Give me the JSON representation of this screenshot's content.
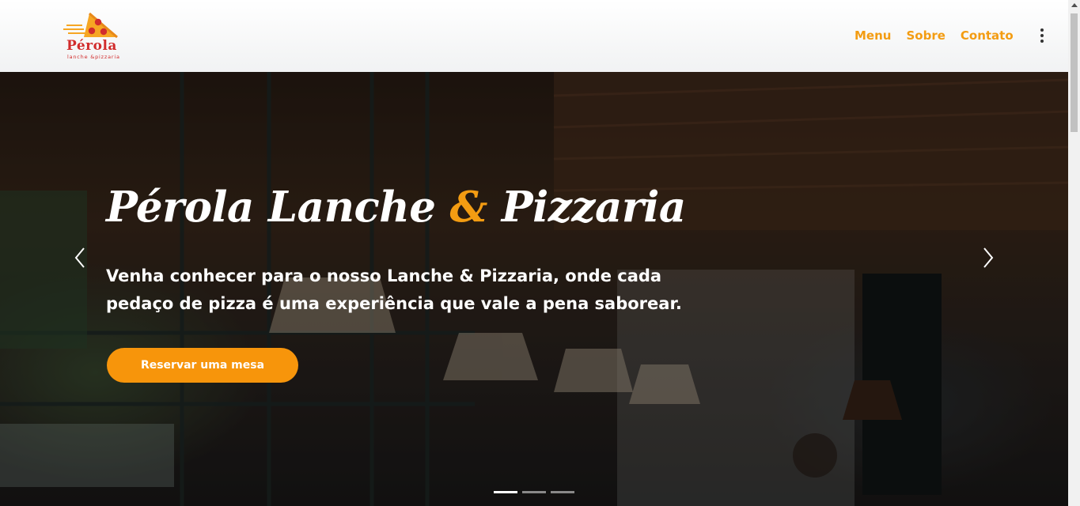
{
  "brand": {
    "name": "Pérola",
    "tagline": "lanche &pizzaria",
    "color": "#d12c2c"
  },
  "nav": {
    "links": [
      {
        "label": "Menu"
      },
      {
        "label": "Sobre"
      },
      {
        "label": "Contato"
      }
    ],
    "more_icon": "more-vertical-icon",
    "accent": "#f39c12"
  },
  "hero": {
    "title_part1": "Pérola Lanche",
    "title_amp": "&",
    "title_part2": "Pizzaria",
    "text": "Venha conhecer para o nosso Lanche & Pizzaria, onde cada pedaço de pizza é uma experiência que vale a pena saborear.",
    "button_label": "Reservar uma mesa",
    "button_color": "#f7950b",
    "prev_icon": "chevron-left-icon",
    "next_icon": "chevron-right-icon",
    "slides_count": 3,
    "active_slide": 1
  }
}
